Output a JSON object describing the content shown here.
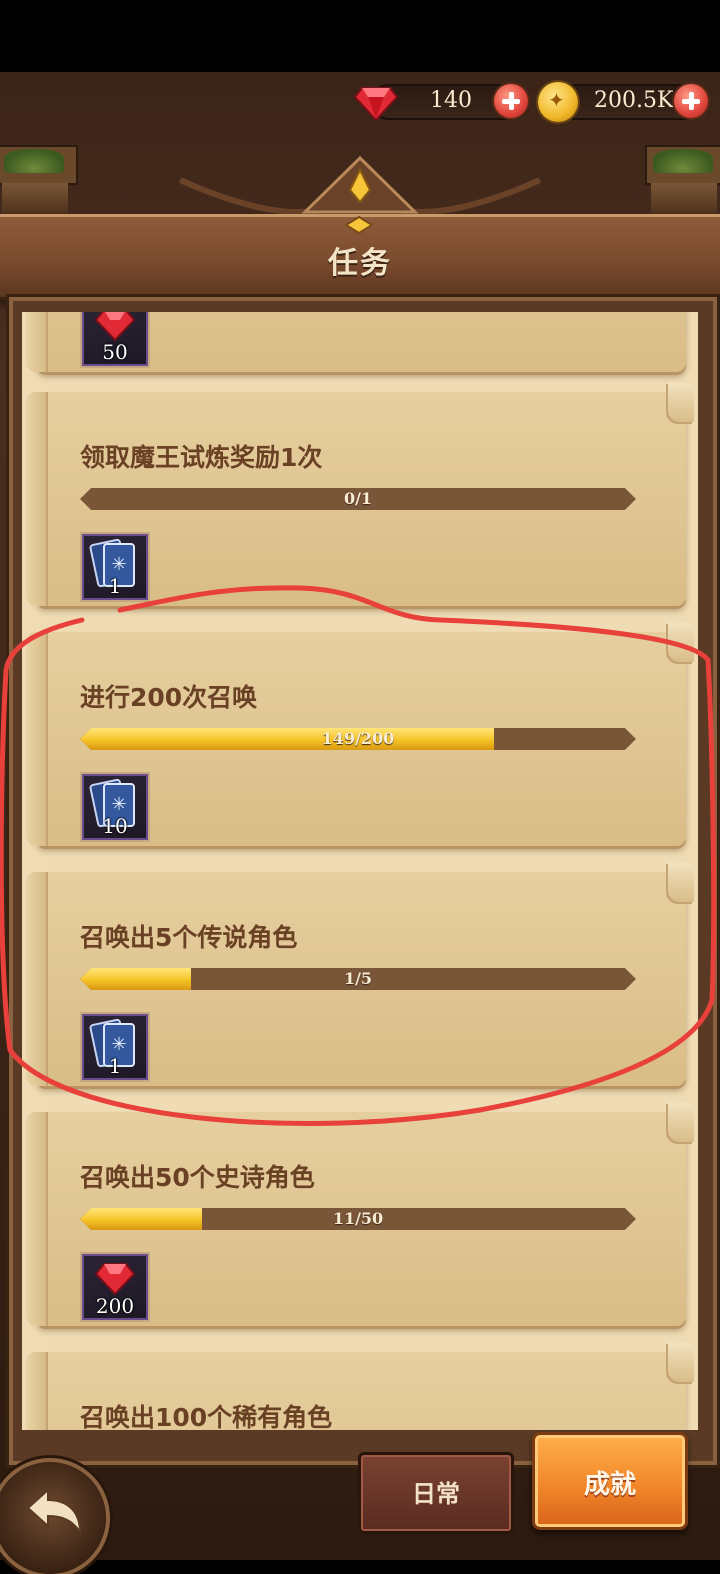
{
  "header": {
    "title": "任务"
  },
  "currency": {
    "gems": "140",
    "gold": "200.5K"
  },
  "tasks": [
    {
      "title": "",
      "progress_text": "",
      "progress": null,
      "reward_type": "gem",
      "reward_count": "50"
    },
    {
      "title": "领取魔王试炼奖励1次",
      "progress_text": "0/1",
      "progress": 0.0,
      "reward_type": "summon-card",
      "reward_count": "1"
    },
    {
      "title": "进行200次召唤",
      "progress_text": "149/200",
      "progress": 0.745,
      "reward_type": "summon-card",
      "reward_count": "10"
    },
    {
      "title": "召唤出5个传说角色",
      "progress_text": "1/5",
      "progress": 0.2,
      "reward_type": "summon-card",
      "reward_count": "1"
    },
    {
      "title": "召唤出50个史诗角色",
      "progress_text": "11/50",
      "progress": 0.22,
      "reward_type": "gem",
      "reward_count": "200"
    },
    {
      "title": "召唤出100个稀有角色",
      "progress_text": "",
      "progress": null,
      "reward_type": "",
      "reward_count": ""
    }
  ],
  "tabs": {
    "daily": "日常",
    "achievement": "成就"
  },
  "colors": {
    "annotation": "#e8403a",
    "progress_fill": "#f5c327",
    "active_tab": "#f2872a"
  }
}
